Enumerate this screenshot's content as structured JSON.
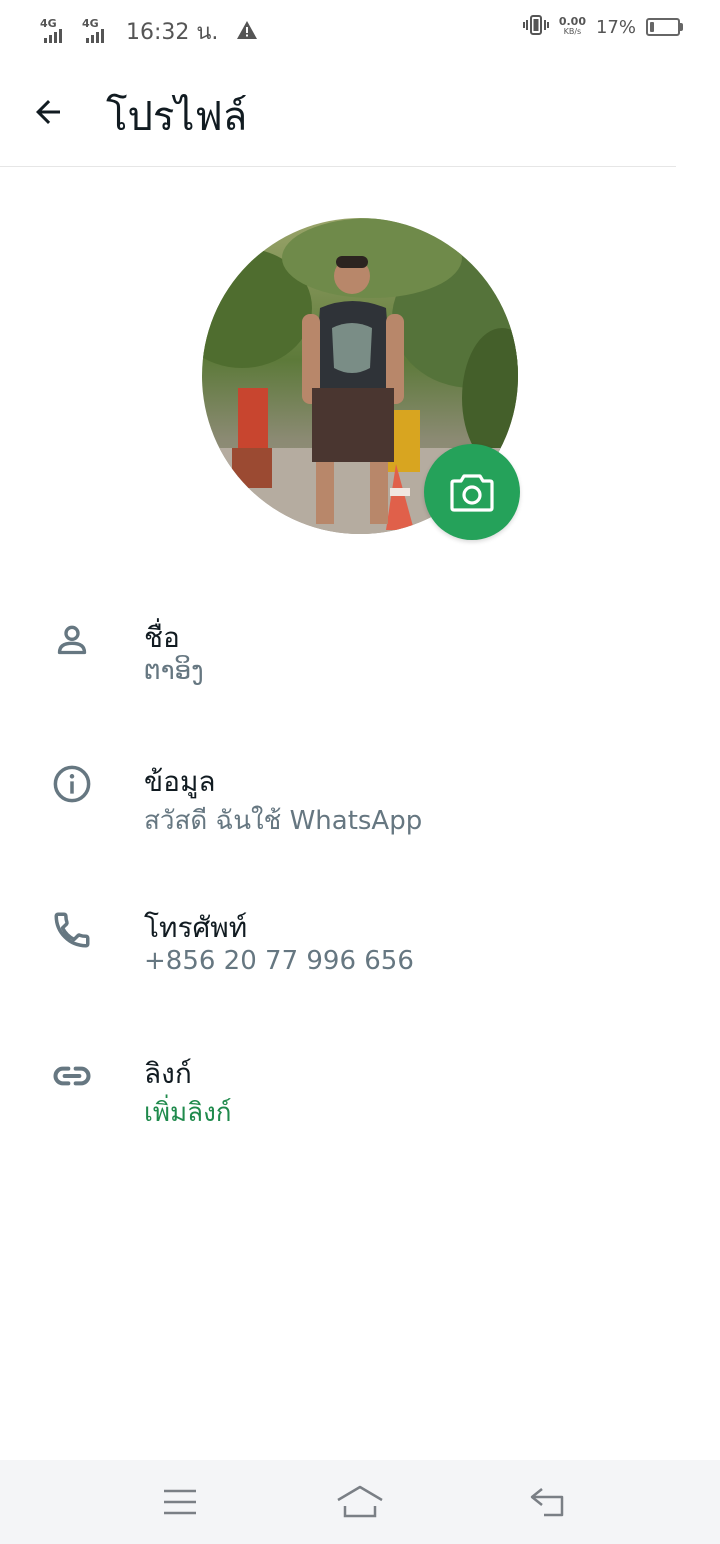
{
  "status_bar": {
    "network_1": "4G",
    "network_2": "4G",
    "time": "16:32 น.",
    "speed_value": "0.00",
    "speed_unit": "KB/s",
    "battery_percent": "17%",
    "battery_level": 0.17
  },
  "app_bar": {
    "title": "โปรไฟล์",
    "back_icon": "arrow-back-icon"
  },
  "avatar": {
    "camera_icon": "camera-icon",
    "accent_color": "#25a25a"
  },
  "rows": [
    {
      "icon": "person-icon",
      "label": "ชื่อ",
      "value": "ຕາອິງ"
    },
    {
      "icon": "info-icon",
      "label": "ข้อมูล",
      "value": "สวัสดี ฉันใช้ WhatsApp"
    },
    {
      "icon": "phone-icon",
      "label": "โทรศัพท์",
      "value": "+856 20 77 996 656"
    },
    {
      "icon": "link-icon",
      "label": "ลิงก์",
      "value": "เพิ่มลิงก์"
    }
  ],
  "nav_bar": {
    "menu_icon": "menu-icon",
    "home_icon": "home-icon",
    "back_icon": "back-icon"
  }
}
